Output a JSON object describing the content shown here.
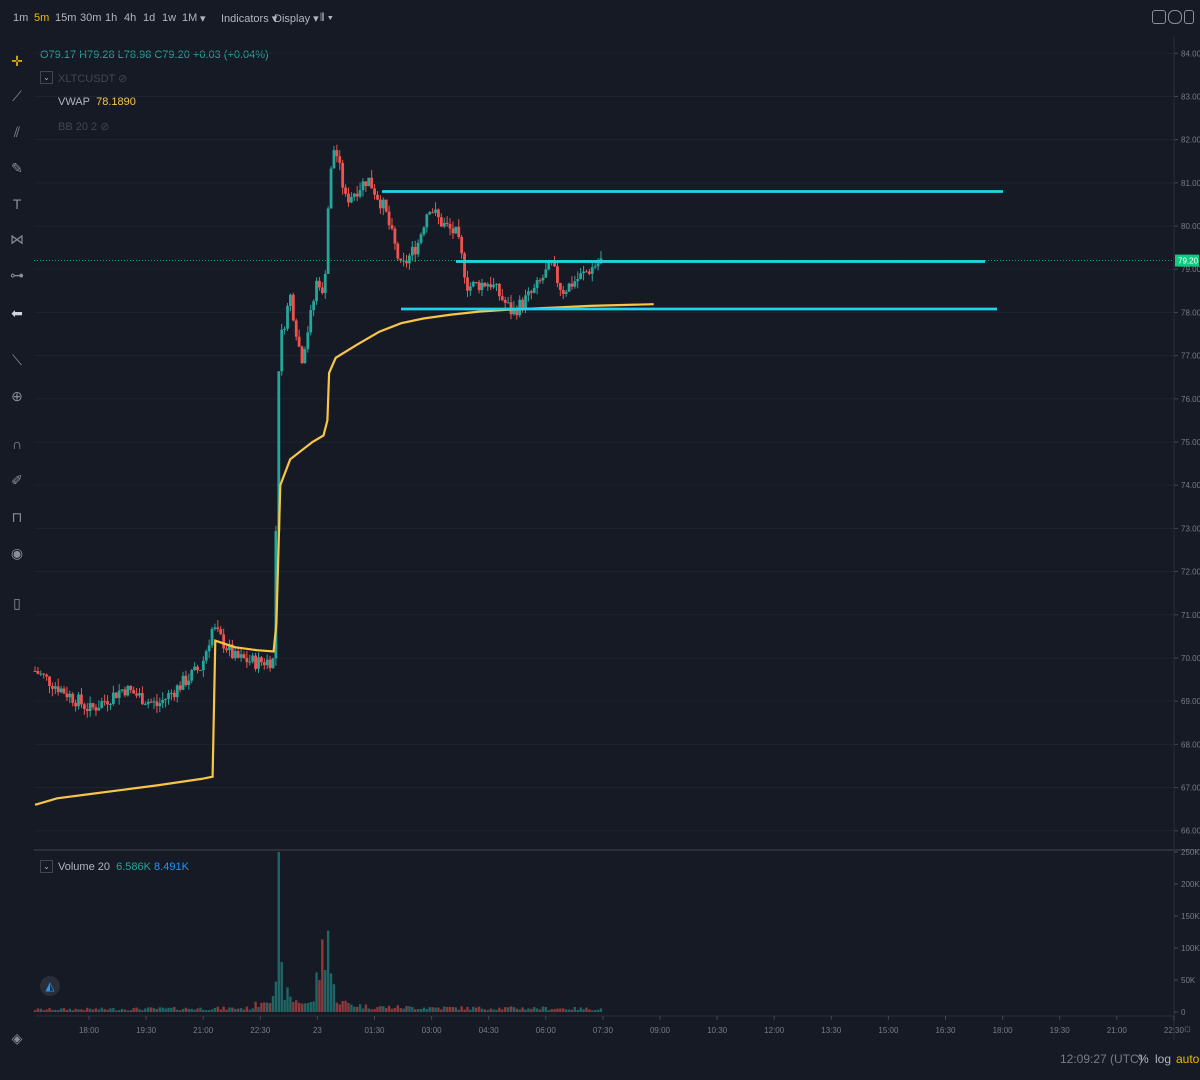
{
  "toolbar": {
    "timeframes": [
      "1m",
      "5m",
      "15m",
      "30m",
      "1h",
      "4h",
      "1d",
      "1w",
      "1M"
    ],
    "active_timeframe": "5m",
    "indicators_label": "Indicators",
    "display_label": "Display"
  },
  "legend": {
    "ohlc": "O79.17  H79.28  L78.98  C79.20  +0.03  (+0.04%)",
    "symbol": "XLTCUSDT",
    "vwap_label": "VWAP",
    "vwap_value": "78.1890",
    "bb_label": "BB 20 2",
    "volume_label": "Volume 20",
    "volume_value1": "6.586K",
    "volume_value2": "8.491K"
  },
  "status": {
    "time": "12:09:27 (UTC)",
    "percent": "%",
    "log": "log",
    "auto": "auto"
  },
  "colors": {
    "background": "#161a25",
    "up": "#26a69a",
    "down": "#ef5350",
    "vwap": "#f7c548",
    "hline": "#22d3ee",
    "last_price": "#0ecb81"
  },
  "chart_data": {
    "type": "candlestick",
    "symbol": "XLTCUSDT",
    "price_axis": {
      "ticks": [
        "84.00",
        "83.00",
        "82.00",
        "81.00",
        "80.00",
        "79.00",
        "78.00",
        "77.00",
        "76.00",
        "75.00",
        "74.00",
        "73.00",
        "72.00",
        "71.00",
        "70.00",
        "69.00",
        "68.00",
        "67.00",
        "66.00"
      ],
      "ylim": [
        65.6,
        84.4
      ],
      "last_price": "79.20"
    },
    "volume_axis": {
      "ticks": [
        "250K",
        "200K",
        "150K",
        "100K",
        "50K",
        "0"
      ],
      "ylim": [
        0,
        250000
      ]
    },
    "time_axis": {
      "ticks": [
        "18:00",
        "19:30",
        "21:00",
        "22:30",
        "23",
        "01:30",
        "03:00",
        "04:30",
        "06:00",
        "07:30",
        "09:00",
        "10:30",
        "12:00",
        "13:30",
        "15:00",
        "16:30",
        "18:00",
        "19:30",
        "21:00",
        "22:30"
      ]
    },
    "horizontal_lines": [
      80.8,
      79.18,
      78.08
    ],
    "vwap_points": [
      [
        0,
        66.6
      ],
      [
        0.4,
        66.75
      ],
      [
        1,
        66.85
      ],
      [
        1.6,
        66.95
      ],
      [
        2.2,
        67.05
      ],
      [
        3,
        67.2
      ],
      [
        3.2,
        67.25
      ],
      [
        3.25,
        70.4
      ],
      [
        3.6,
        70.25
      ],
      [
        4,
        70.18
      ],
      [
        4.3,
        70.15
      ],
      [
        4.35,
        70.8
      ],
      [
        4.42,
        74.0
      ],
      [
        4.6,
        74.6
      ],
      [
        5,
        75.0
      ],
      [
        5.2,
        75.15
      ],
      [
        5.27,
        75.5
      ],
      [
        5.3,
        76.6
      ],
      [
        5.42,
        76.95
      ],
      [
        5.8,
        77.25
      ],
      [
        6.2,
        77.55
      ],
      [
        6.6,
        77.75
      ],
      [
        7,
        77.86
      ],
      [
        7.5,
        77.95
      ],
      [
        8,
        78.02
      ],
      [
        8.5,
        78.06
      ],
      [
        9,
        78.09
      ],
      [
        9.5,
        78.12
      ],
      [
        10,
        78.15
      ],
      [
        10.5,
        78.17
      ],
      [
        11.15,
        78.19
      ]
    ],
    "candle_path": [
      [
        0,
        69.7
      ],
      [
        1.0,
        68.8
      ],
      [
        1.6,
        69.3
      ],
      [
        2.2,
        68.9
      ],
      [
        3.0,
        69.8
      ],
      [
        3.2,
        70.7
      ],
      [
        3.6,
        70.0
      ],
      [
        4.0,
        69.9
      ],
      [
        4.3,
        69.95
      ],
      [
        4.4,
        77.2
      ],
      [
        4.6,
        78.4
      ],
      [
        4.8,
        76.9
      ],
      [
        5.0,
        78.1
      ],
      [
        5.1,
        78.9
      ],
      [
        5.2,
        78.2
      ],
      [
        5.3,
        80.9
      ],
      [
        5.4,
        81.9
      ],
      [
        5.6,
        80.6
      ],
      [
        6.0,
        81.1
      ],
      [
        6.3,
        80.4
      ],
      [
        6.6,
        79.0
      ],
      [
        6.9,
        79.6
      ],
      [
        7.1,
        80.5
      ],
      [
        7.3,
        80.1
      ],
      [
        7.6,
        79.8
      ],
      [
        7.8,
        78.6
      ],
      [
        8.2,
        78.7
      ],
      [
        8.6,
        78.0
      ],
      [
        9.0,
        78.5
      ],
      [
        9.3,
        79.1
      ],
      [
        9.5,
        78.5
      ],
      [
        9.8,
        78.8
      ],
      [
        10.0,
        79.0
      ],
      [
        10.2,
        79.2
      ]
    ],
    "volume_profile": [
      [
        0,
        4
      ],
      [
        3.9,
        6
      ],
      [
        4.35,
        35
      ],
      [
        4.4,
        240
      ],
      [
        4.45,
        40
      ],
      [
        4.6,
        20
      ],
      [
        5.0,
        12
      ],
      [
        5.28,
        138
      ],
      [
        5.35,
        40
      ],
      [
        5.5,
        15
      ],
      [
        6,
        8
      ],
      [
        7,
        7
      ],
      [
        8,
        6
      ],
      [
        9,
        6
      ],
      [
        10,
        5
      ],
      [
        10.2,
        5
      ]
    ],
    "candle_count": 196,
    "seed": 7
  }
}
